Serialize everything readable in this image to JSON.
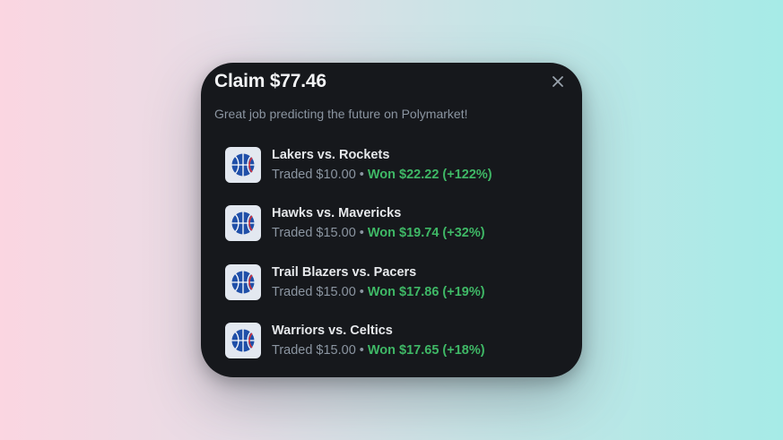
{
  "modal": {
    "title": "Claim $77.46",
    "subtitle": "Great job predicting the future on Polymarket!",
    "close_icon": "close-icon"
  },
  "colors": {
    "modal_bg": "#16181c",
    "won_green": "#3fb866",
    "muted_text": "#8b95a1"
  },
  "items": [
    {
      "title": "Lakers vs. Rockets",
      "traded": "Traded $10.00",
      "separator": "•",
      "won": "Won $22.22 (+122%)",
      "icon": "basketball-icon"
    },
    {
      "title": "Hawks vs. Mavericks",
      "traded": "Traded $15.00",
      "separator": "•",
      "won": "Won $19.74 (+32%)",
      "icon": "basketball-icon"
    },
    {
      "title": "Trail Blazers vs. Pacers",
      "traded": "Traded $15.00",
      "separator": "•",
      "won": "Won $17.86 (+19%)",
      "icon": "basketball-icon"
    },
    {
      "title": "Warriors vs. Celtics",
      "traded": "Traded $15.00",
      "separator": "•",
      "won": "Won $17.65 (+18%)",
      "icon": "basketball-icon"
    }
  ]
}
